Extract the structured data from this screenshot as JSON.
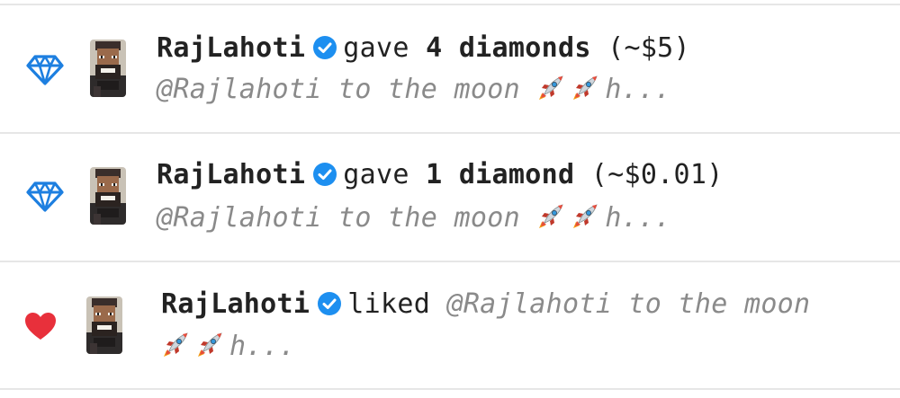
{
  "colors": {
    "diamond": "#1d7fe0",
    "heart": "#e8303b",
    "verified": "#1d8ff0",
    "text": "#222222",
    "muted": "#8a8a8a",
    "divider": "#e6e6e6"
  },
  "notifications": [
    {
      "type_icon": "diamond-icon",
      "username": "RajLahoti",
      "action": "gave",
      "amount": "4 diamonds",
      "value": "(~$5)",
      "preview_text": "@Rajlahoti to the moon",
      "preview_tail": "h..."
    },
    {
      "type_icon": "diamond-icon",
      "username": "RajLahoti",
      "action": "gave",
      "amount": "1 diamond",
      "value": "(~$0.01)",
      "preview_text": "@Rajlahoti to the moon",
      "preview_tail": "h..."
    },
    {
      "type_icon": "heart-icon",
      "username": "RajLahoti",
      "action": "liked",
      "preview_text": "@Rajlahoti to the moon",
      "preview_tail": "h..."
    }
  ]
}
